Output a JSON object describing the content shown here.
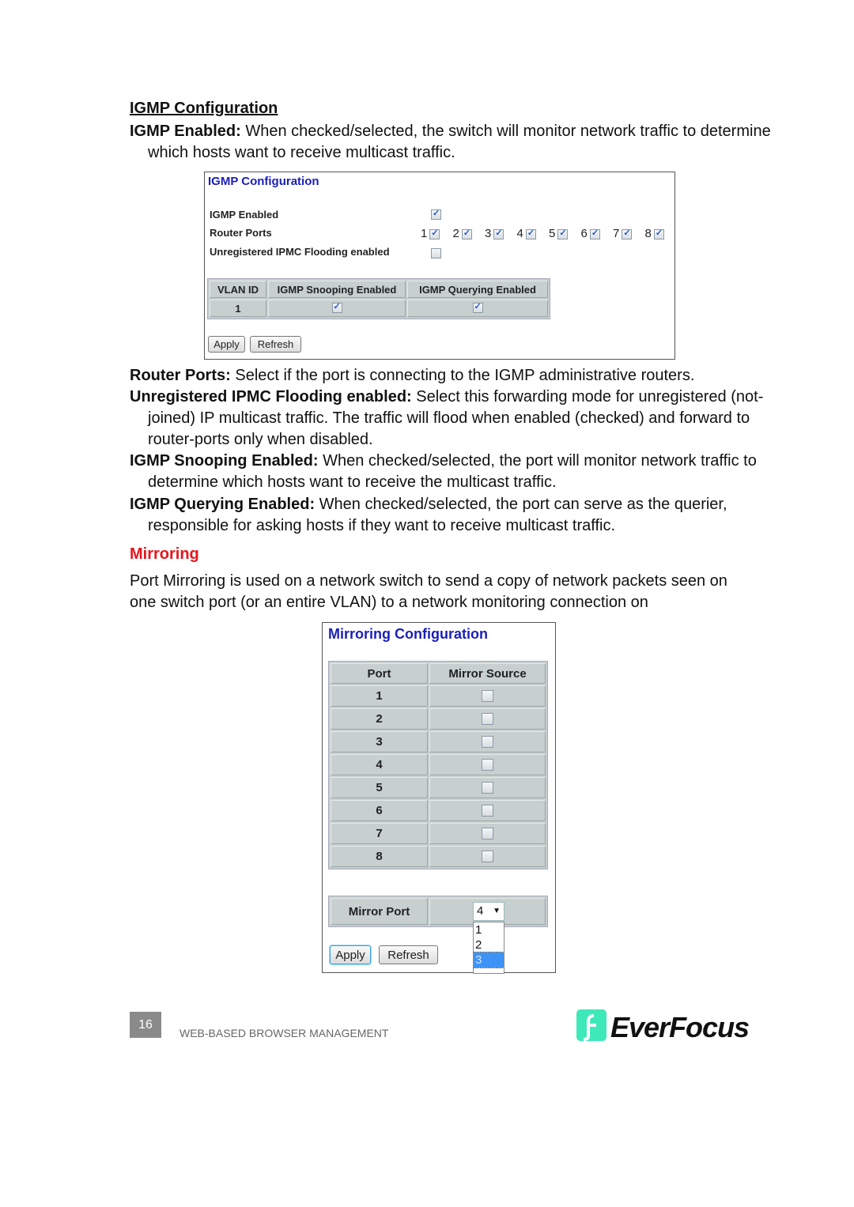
{
  "igmp_section": {
    "heading": "IGMP Configuration",
    "enabled_desc": {
      "term": "IGMP Enabled:",
      "text": " When checked/selected, the switch will monitor network traffic to determine which hosts want to receive multicast traffic."
    },
    "screenshot": {
      "title": "IGMP Configuration",
      "igmp_enabled_label": "IGMP Enabled",
      "igmp_enabled": true,
      "router_ports_label": "Router Ports",
      "router_ports": [
        {
          "port": "1",
          "checked": true
        },
        {
          "port": "2",
          "checked": true
        },
        {
          "port": "3",
          "checked": true
        },
        {
          "port": "4",
          "checked": true
        },
        {
          "port": "5",
          "checked": true
        },
        {
          "port": "6",
          "checked": true
        },
        {
          "port": "7",
          "checked": true
        },
        {
          "port": "8",
          "checked": true
        }
      ],
      "flooding_label": "Unregistered IPMC Flooding enabled",
      "flooding_enabled": false,
      "vlan_table": {
        "headers": [
          "VLAN ID",
          "IGMP Snooping Enabled",
          "IGMP Querying Enabled"
        ],
        "rows": [
          {
            "vlan_id": "1",
            "snooping": true,
            "querying": true
          }
        ]
      },
      "apply_label": "Apply",
      "refresh_label": "Refresh"
    },
    "descriptions": [
      {
        "term": "Router Ports:",
        "text": " Select if the port is connecting to the IGMP administrative routers."
      },
      {
        "term": "Unregistered IPMC Flooding enabled:",
        "text": " Select this forwarding mode for unregistered (not-joined) IP multicast traffic. The traffic will flood when enabled (checked) and forward to router-ports only when disabled."
      },
      {
        "term": "IGMP Snooping Enabled:",
        "text": " When checked/selected, the port will monitor network traffic to determine which hosts want to receive the multicast traffic."
      },
      {
        "term": "IGMP Querying Enabled:",
        "text": " When checked/selected, the port can serve as the querier, responsible for asking hosts if they want to receive multicast traffic."
      }
    ]
  },
  "mirroring_section": {
    "heading": "Mirroring",
    "intro": "Port Mirroring is used on a network switch to send a copy of network packets seen on one switch port (or an entire VLAN) to a network monitoring connection on",
    "screenshot": {
      "title": "Mirroring Configuration",
      "headers": [
        "Port",
        "Mirror Source"
      ],
      "rows": [
        {
          "port": "1",
          "checked": false
        },
        {
          "port": "2",
          "checked": false
        },
        {
          "port": "3",
          "checked": false
        },
        {
          "port": "4",
          "checked": false
        },
        {
          "port": "5",
          "checked": false
        },
        {
          "port": "6",
          "checked": false
        },
        {
          "port": "7",
          "checked": false
        },
        {
          "port": "8",
          "checked": false
        }
      ],
      "mirror_port_label": "Mirror Port",
      "mirror_port_value": "4",
      "dropdown_options": [
        "1",
        "2",
        "3"
      ],
      "dropdown_highlighted": "3",
      "apply_label": "Apply",
      "refresh_label": "Refresh"
    }
  },
  "footer": {
    "page_number": "16",
    "running_title": "WEB-BASED BROWSER MANAGEMENT",
    "logo_text": "EverFocus",
    "logo_color": "#3fe8b8"
  },
  "colors": {
    "mirroring_heading": "#e8141c",
    "panel_title": "#1a1fb8",
    "table_bg": "#c7cfcf"
  }
}
